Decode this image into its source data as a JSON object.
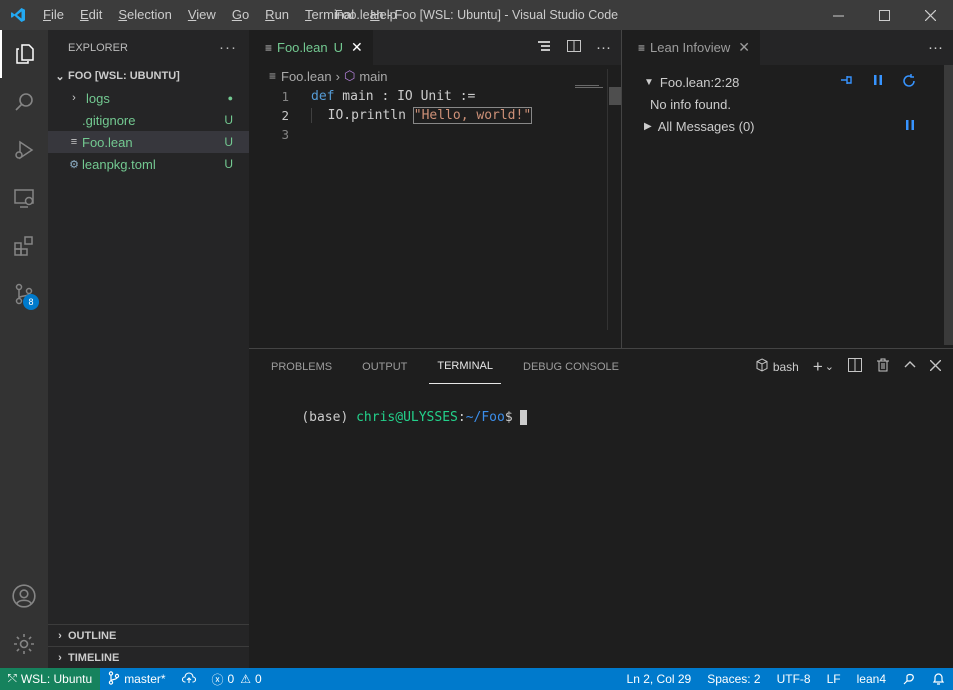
{
  "titlebar": {
    "menu": [
      "File",
      "Edit",
      "Selection",
      "View",
      "Go",
      "Run",
      "Terminal",
      "Help"
    ],
    "menu_underline": [
      "F",
      "E",
      "S",
      "V",
      "G",
      "R",
      "T",
      "H"
    ],
    "title": "Foo.lean - Foo [WSL: Ubuntu] - Visual Studio Code"
  },
  "activitybar": {
    "items": [
      "explorer-icon",
      "search-icon",
      "run-debug-icon",
      "remote-explorer-icon",
      "extensions-icon",
      "source-control-icon"
    ],
    "source_control_badge": "8",
    "bottom": [
      "account-icon",
      "settings-gear-icon"
    ]
  },
  "sidebar": {
    "header": "EXPLORER",
    "root": "FOO [WSL: UBUNTU]",
    "items": [
      {
        "label": "logs",
        "kind": "folder",
        "decoration": "●"
      },
      {
        "label": ".gitignore",
        "kind": "file",
        "decoration": "U"
      },
      {
        "label": "Foo.lean",
        "kind": "lean",
        "decoration": "U"
      },
      {
        "label": "leanpkg.toml",
        "kind": "config",
        "decoration": "U"
      }
    ],
    "outline": "OUTLINE",
    "timeline": "TIMELINE"
  },
  "editor": {
    "tab_label": "Foo.lean",
    "tab_status": "U",
    "breadcrumb_file": "Foo.lean",
    "breadcrumb_symbol": "main",
    "lines": [
      {
        "num": "1",
        "kw": "def",
        "rest": " main : IO Unit :="
      },
      {
        "num": "2",
        "pre": "  IO.println ",
        "str": "\"Hello, world!\""
      },
      {
        "num": "3",
        "text": ""
      }
    ]
  },
  "infoview": {
    "tab_label": "Lean Infoview",
    "location": "Foo.lean:2:28",
    "no_info": "No info found.",
    "all_messages": "All Messages (0)"
  },
  "panel": {
    "tabs": [
      "PROBLEMS",
      "OUTPUT",
      "TERMINAL",
      "DEBUG CONSOLE"
    ],
    "active_tab": "TERMINAL",
    "shell": "bash",
    "prompt_env": "(base) ",
    "prompt_user": "chris@ULYSSES",
    "prompt_sep": ":",
    "prompt_path": "~/Foo",
    "prompt_end": "$ "
  },
  "statusbar": {
    "remote": "WSL: Ubuntu",
    "branch": "master*",
    "errors": "0",
    "warnings": "0",
    "position": "Ln 2, Col 29",
    "spaces": "Spaces: 2",
    "encoding": "UTF-8",
    "eol": "LF",
    "language": "lean4"
  },
  "colors": {
    "accent": "#007acc",
    "remote": "#16825d",
    "git_untracked": "#73c991",
    "keyword": "#569cd6",
    "string": "#ce9178"
  }
}
